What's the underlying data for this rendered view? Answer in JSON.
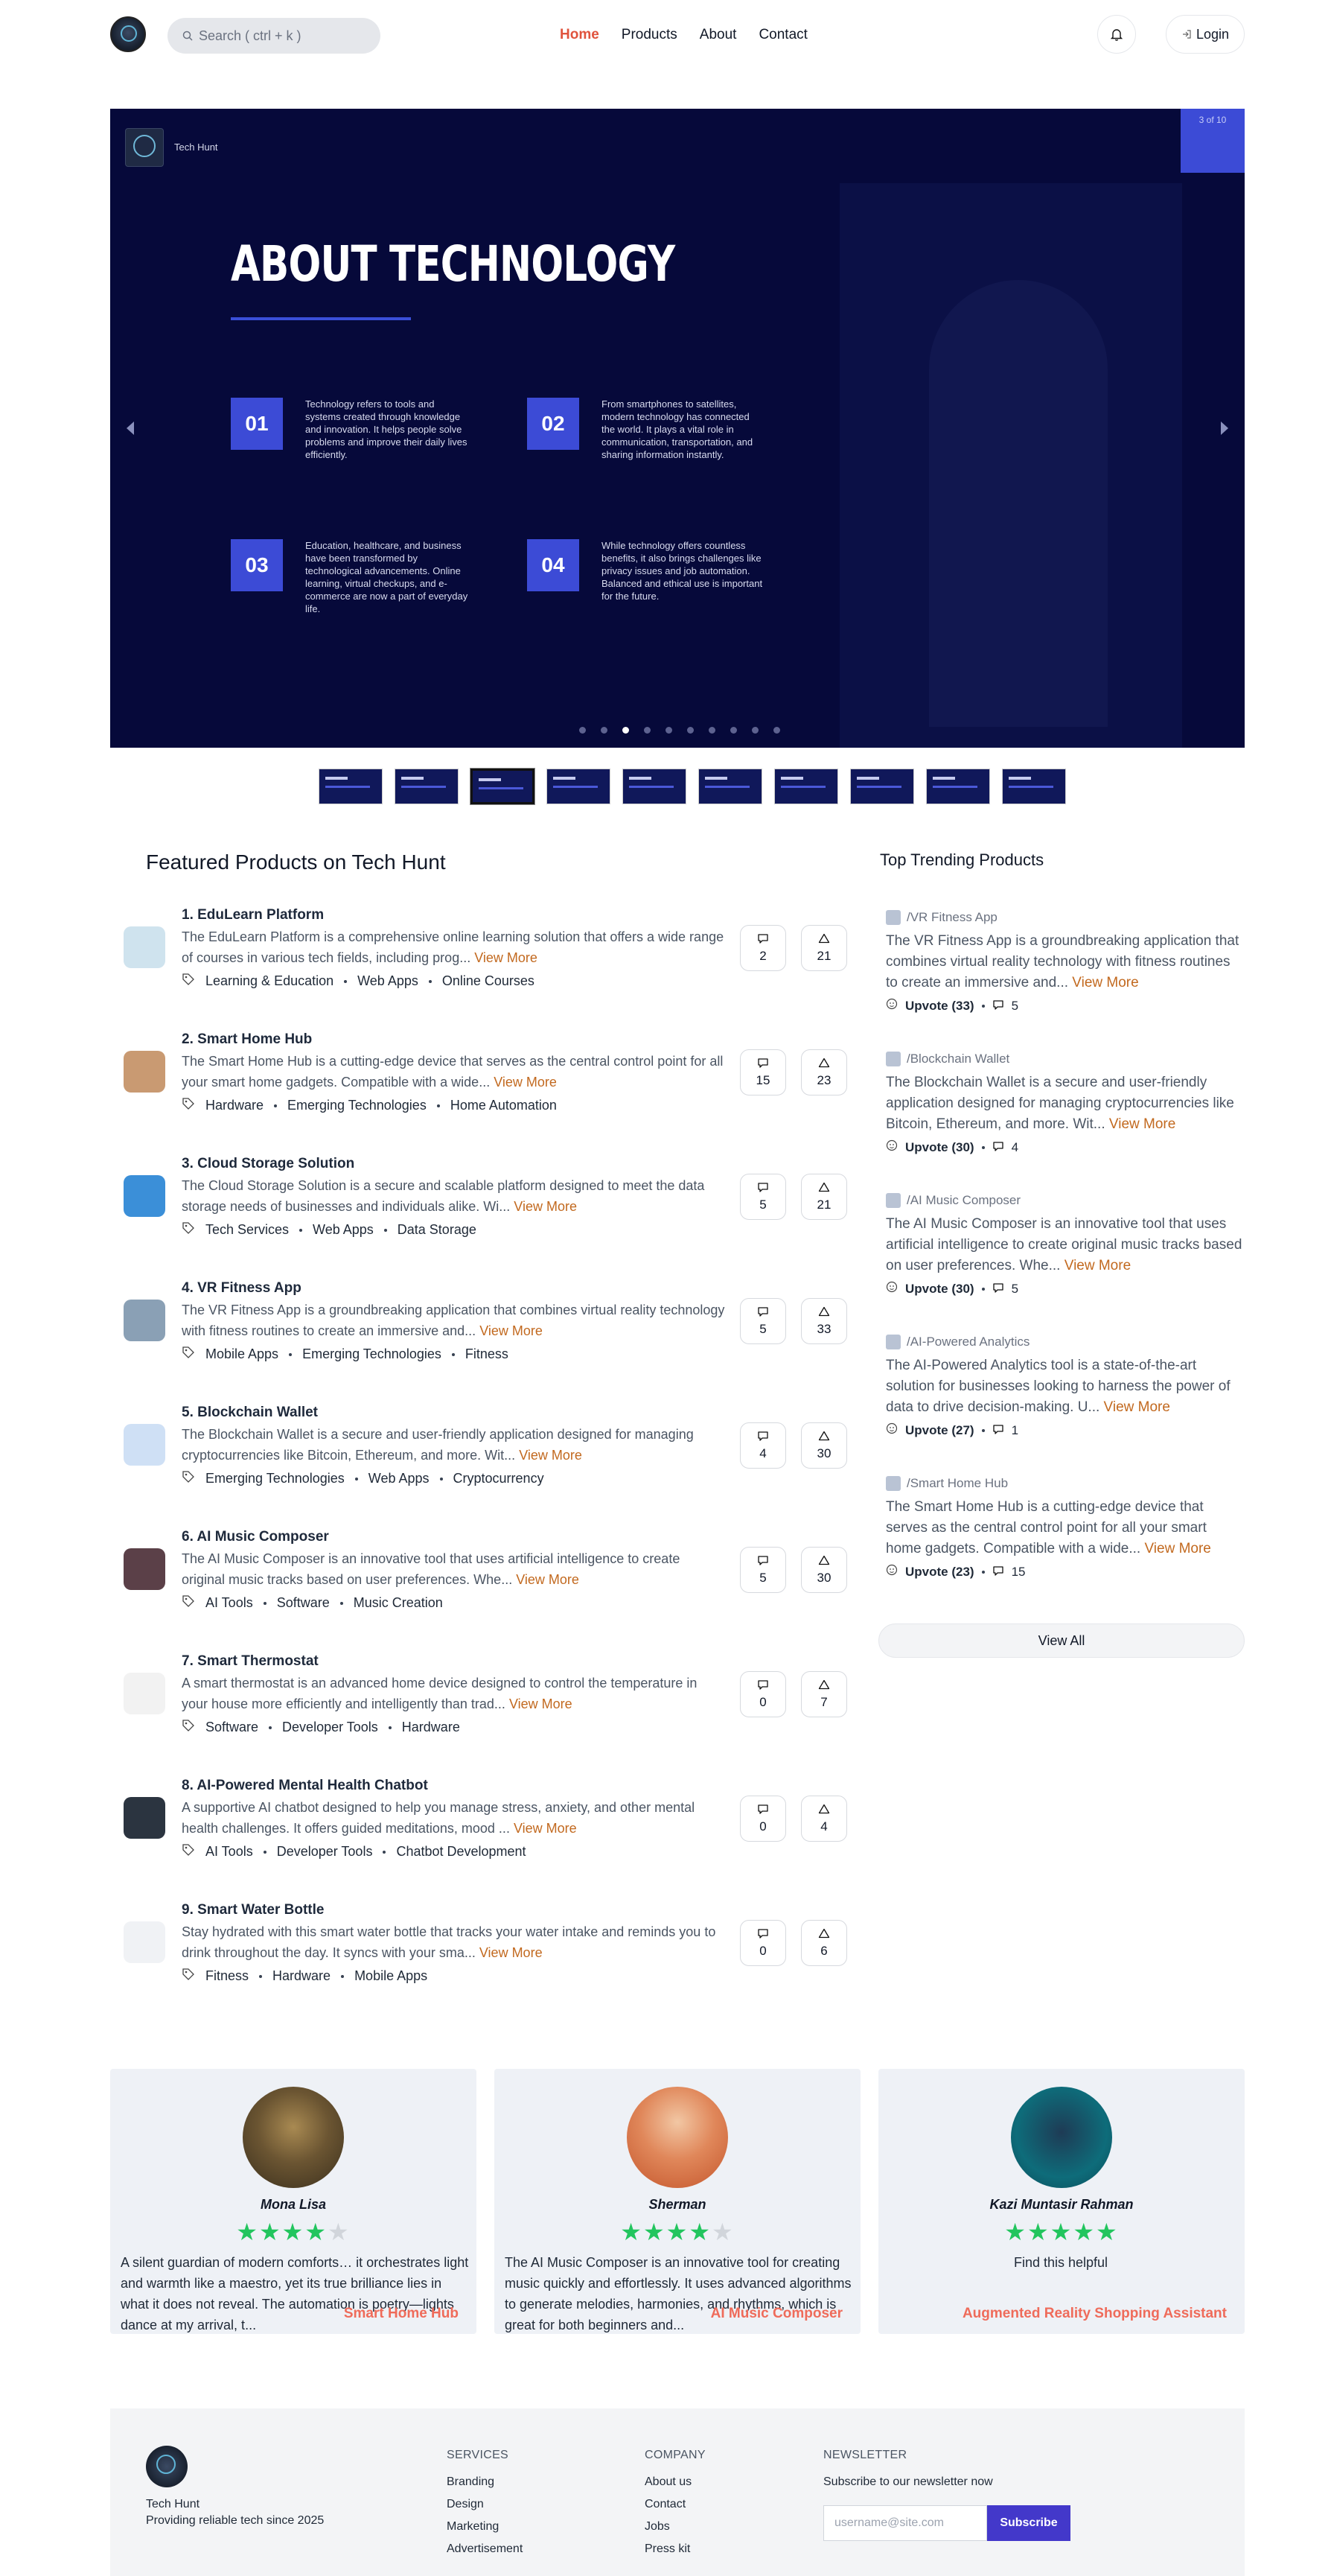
{
  "nav": {
    "search_placeholder": "Search ( ctrl + k )",
    "links": [
      "Home",
      "Products",
      "About",
      "Contact"
    ],
    "login_label": "Login"
  },
  "hero": {
    "counter": "3 of 10",
    "brand": "Tech Hunt",
    "title": "ABOUT TECHNOLOGY",
    "features": [
      {
        "num": "01",
        "text": "Technology refers to tools and systems created through knowledge and innovation. It helps people solve problems and improve their daily lives efficiently."
      },
      {
        "num": "02",
        "text": "From smartphones to satellites, modern technology has connected the world. It plays a vital role in communication, transportation, and sharing information instantly."
      },
      {
        "num": "03",
        "text": "Education, healthcare, and business have been transformed by technological advancements. Online learning, virtual checkups, and e-commerce are now a part of everyday life."
      },
      {
        "num": "04",
        "text": "While technology offers countless benefits, it also brings challenges like privacy issues and job automation. Balanced and ethical use is important for the future."
      }
    ],
    "active_slide": 3,
    "slide_count": 10
  },
  "featured": {
    "heading": "Featured Products on Tech Hunt",
    "view_more": "View More",
    "products": [
      {
        "title": "1. EduLearn Platform",
        "desc": "The EduLearn Platform is a comprehensive online learning solution that offers a wide range of courses in various tech fields, including prog...",
        "tags": [
          "Learning & Education",
          "Web Apps",
          "Online Courses"
        ],
        "comments": "2",
        "upvotes": "21"
      },
      {
        "title": "2. Smart Home Hub",
        "desc": "The Smart Home Hub is a cutting-edge device that serves as the central control point for all your smart home gadgets. Compatible with a wide...",
        "tags": [
          "Hardware",
          "Emerging Technologies",
          "Home Automation"
        ],
        "comments": "15",
        "upvotes": "23"
      },
      {
        "title": "3. Cloud Storage Solution",
        "desc": "The Cloud Storage Solution is a secure and scalable platform designed to meet the data storage needs of businesses and individuals alike. Wi...",
        "tags": [
          "Tech Services",
          "Web Apps",
          "Data Storage"
        ],
        "comments": "5",
        "upvotes": "21"
      },
      {
        "title": "4. VR Fitness App",
        "desc": "The VR Fitness App is a groundbreaking application that combines virtual reality technology with fitness routines to create an immersive and...",
        "tags": [
          "Mobile Apps",
          "Emerging Technologies",
          "Fitness"
        ],
        "comments": "5",
        "upvotes": "33"
      },
      {
        "title": "5. Blockchain Wallet",
        "desc": "The Blockchain Wallet is a secure and user-friendly application designed for managing cryptocurrencies like Bitcoin, Ethereum, and more. Wit...",
        "tags": [
          "Emerging Technologies",
          "Web Apps",
          "Cryptocurrency"
        ],
        "comments": "4",
        "upvotes": "30"
      },
      {
        "title": "6. AI Music Composer",
        "desc": "The AI Music Composer is an innovative tool that uses artificial intelligence to create original music tracks based on user preferences. Whe...",
        "tags": [
          "AI Tools",
          "Software",
          "Music Creation"
        ],
        "comments": "5",
        "upvotes": "30"
      },
      {
        "title": "7. Smart Thermostat",
        "desc": "A smart thermostat is an advanced home device designed to control the temperature in your house more efficiently and intelligently than trad...",
        "tags": [
          "Software",
          "Developer Tools",
          "Hardware"
        ],
        "comments": "0",
        "upvotes": "7"
      },
      {
        "title": "8. AI-Powered Mental Health Chatbot",
        "desc": "A supportive AI chatbot designed to help you manage stress, anxiety, and other mental health challenges. It offers guided meditations, mood ...",
        "tags": [
          "AI Tools",
          "Developer Tools",
          "Chatbot Development"
        ],
        "comments": "0",
        "upvotes": "4"
      },
      {
        "title": "9. Smart Water Bottle",
        "desc": "Stay hydrated with this smart water bottle that tracks your water intake and reminds you to drink throughout the day. It syncs with your sma...",
        "tags": [
          "Fitness",
          "Hardware",
          "Mobile Apps"
        ],
        "comments": "0",
        "upvotes": "6"
      }
    ]
  },
  "trending": {
    "heading": "Top Trending Products",
    "view_more": "View More",
    "items": [
      {
        "title": "/VR Fitness App",
        "desc": "The VR Fitness App is a groundbreaking application that combines virtual reality technology with fitness routines to create an immersive and...",
        "upvotes": "Upvote (33)",
        "comments": "5"
      },
      {
        "title": "/Blockchain Wallet",
        "desc": "The Blockchain Wallet is a secure and user-friendly application designed for managing cryptocurrencies like Bitcoin, Ethereum, and more. Wit...",
        "upvotes": "Upvote (30)",
        "comments": "4"
      },
      {
        "title": "/AI Music Composer",
        "desc": "The AI Music Composer is an innovative tool that uses artificial intelligence to create original music tracks based on user preferences. Whe...",
        "upvotes": "Upvote (30)",
        "comments": "5"
      },
      {
        "title": "/AI-Powered Analytics",
        "desc": "The AI-Powered Analytics tool is a state-of-the-art solution for businesses looking to harness the power of data to drive decision-making. U...",
        "upvotes": "Upvote (27)",
        "comments": "1"
      },
      {
        "title": "/Smart Home Hub",
        "desc": "The Smart Home Hub is a cutting-edge device that serves as the central control point for all your smart home gadgets. Compatible with a wide...",
        "upvotes": "Upvote (23)",
        "comments": "15"
      }
    ],
    "view_all": "View All"
  },
  "testimonials": [
    {
      "name": "Mona Lisa",
      "rating": 4,
      "text": "A silent guardian of modern comforts… it orchestrates light and warmth like a maestro, yet its true brilliance lies in what it does not reveal. The automation is poetry—lights dance at my arrival, t...",
      "product": "Smart Home Hub"
    },
    {
      "name": "Sherman",
      "rating": 4,
      "text": "The AI Music Composer is an innovative tool for creating music quickly and effortlessly. It uses advanced algorithms to generate melodies, harmonies, and rhythms, which is great for both beginners and...",
      "product": "AI Music Composer"
    },
    {
      "name": "Kazi Muntasir Rahman",
      "rating": 5,
      "text": "Find this helpful",
      "product": "Augmented Reality Shopping Assistant"
    }
  ],
  "footer": {
    "brand": "Tech Hunt",
    "tagline": "Providing reliable tech since 2025",
    "services_heading": "SERVICES",
    "services": [
      "Branding",
      "Design",
      "Marketing",
      "Advertisement"
    ],
    "company_heading": "COMPANY",
    "company": [
      "About us",
      "Contact",
      "Jobs",
      "Press kit"
    ],
    "newsletter_heading": "NEWSLETTER",
    "newsletter_text": "Subscribe to our newsletter now",
    "newsletter_placeholder": "username@site.com",
    "subscribe_label": "Subscribe"
  },
  "colors": {
    "accent": "#e0533d",
    "hero_bg": "#06093a",
    "hero_blue": "#3c4bd6",
    "link_orange": "#c2691f",
    "star_green": "#22c55e",
    "subscribe": "#4338ca"
  }
}
